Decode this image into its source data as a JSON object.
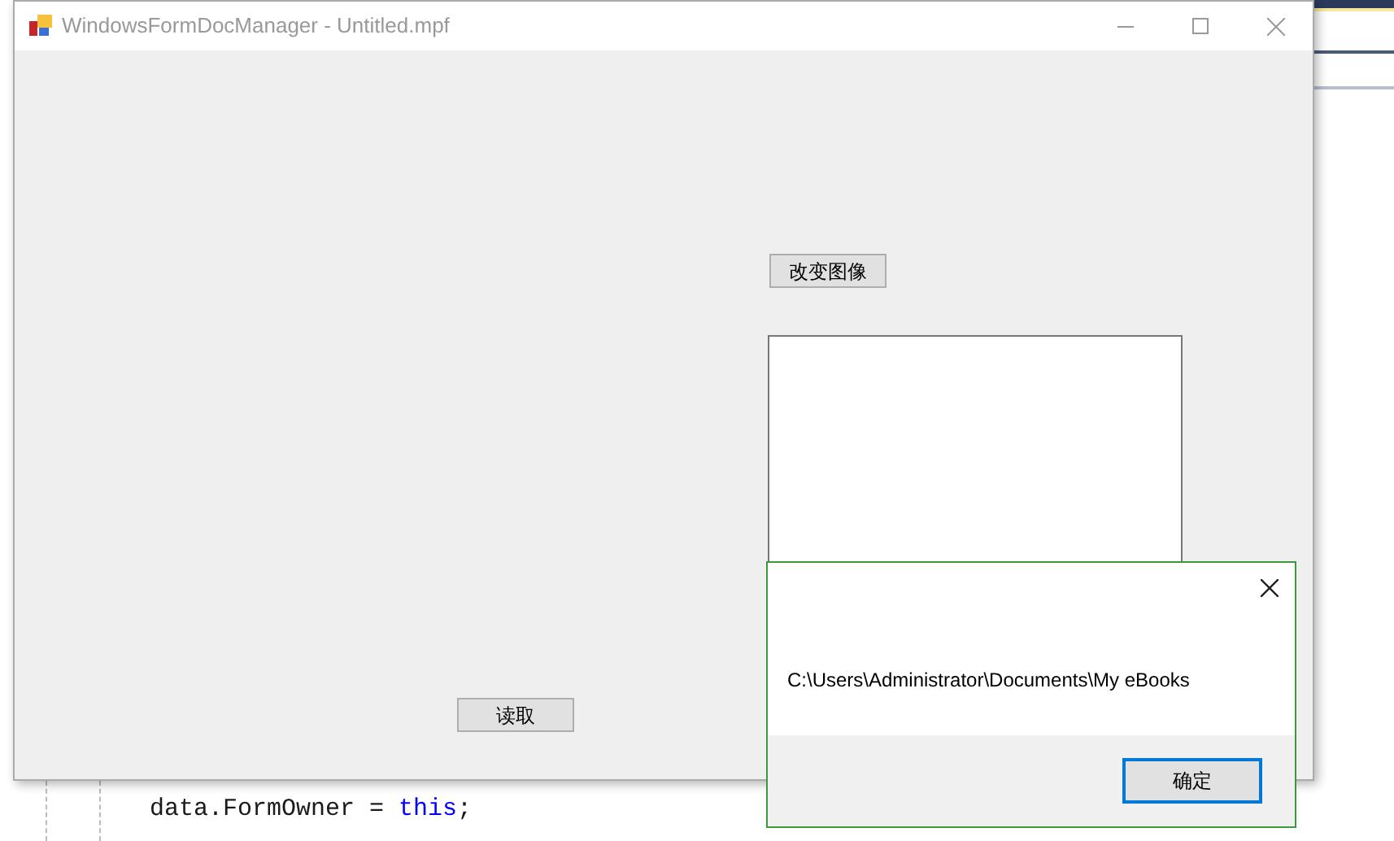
{
  "main_window": {
    "title": "WindowsFormDocManager - Untitled.mpf",
    "buttons": [
      {
        "kind": "change",
        "label": "改变图像"
      },
      {
        "kind": "read",
        "label": "读取"
      }
    ]
  },
  "code_editor": {
    "lines": [
      {
        "kind": "assign",
        "parts": [
          "data.FormOwner = ",
          "this",
          ";"
        ]
      }
    ]
  },
  "message_box": {
    "message": "C:\\Users\\Administrator\\Documents\\My eBooks",
    "ok_button": "确定"
  }
}
